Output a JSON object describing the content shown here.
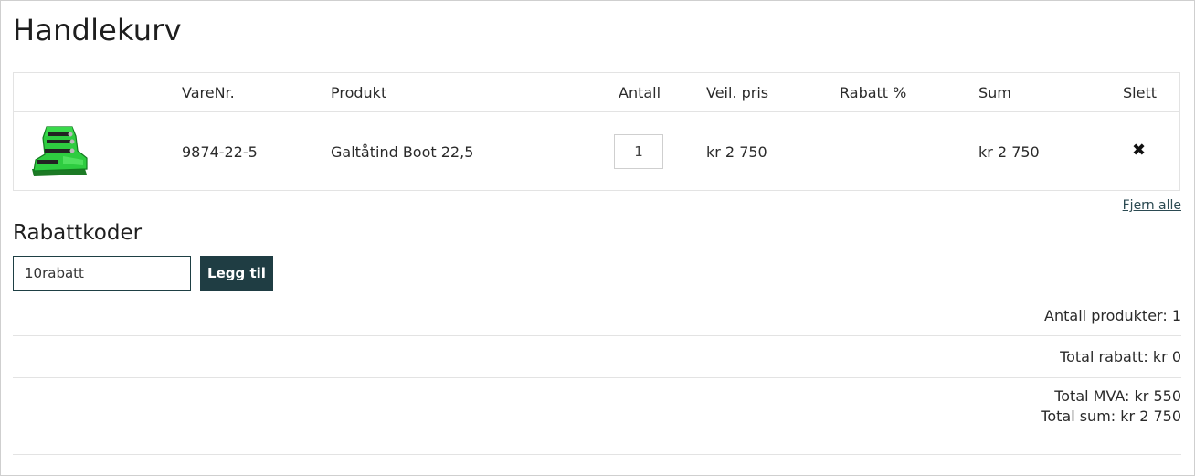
{
  "page": {
    "title": "Handlekurv"
  },
  "cart": {
    "headers": [
      "VareNr.",
      "Produkt",
      "Antall",
      "Veil. pris",
      "Rabatt %",
      "Sum",
      "Slett"
    ],
    "items": [
      {
        "sku": "9874-22-5",
        "product": "Galtåtind Boot 22,5",
        "quantity": "1",
        "list_price": "kr 2 750",
        "discount": "",
        "sum": "kr 2 750",
        "image_icon": "ski-boot-image",
        "image_color": "#2ecc40"
      }
    ],
    "delete_icon": "close-icon",
    "remove_all_label": "Fjern alle"
  },
  "discount_codes": {
    "title": "Rabattkoder",
    "input_value": "10rabatt",
    "button_label": "Legg til",
    "button_color": "#1f3d43"
  },
  "summary": {
    "product_count": "Antall produkter: 1",
    "total_discount": "Total rabatt: kr 0",
    "total_vat": "Total MVA: kr 550",
    "total_sum": "Total sum: kr 2 750"
  }
}
